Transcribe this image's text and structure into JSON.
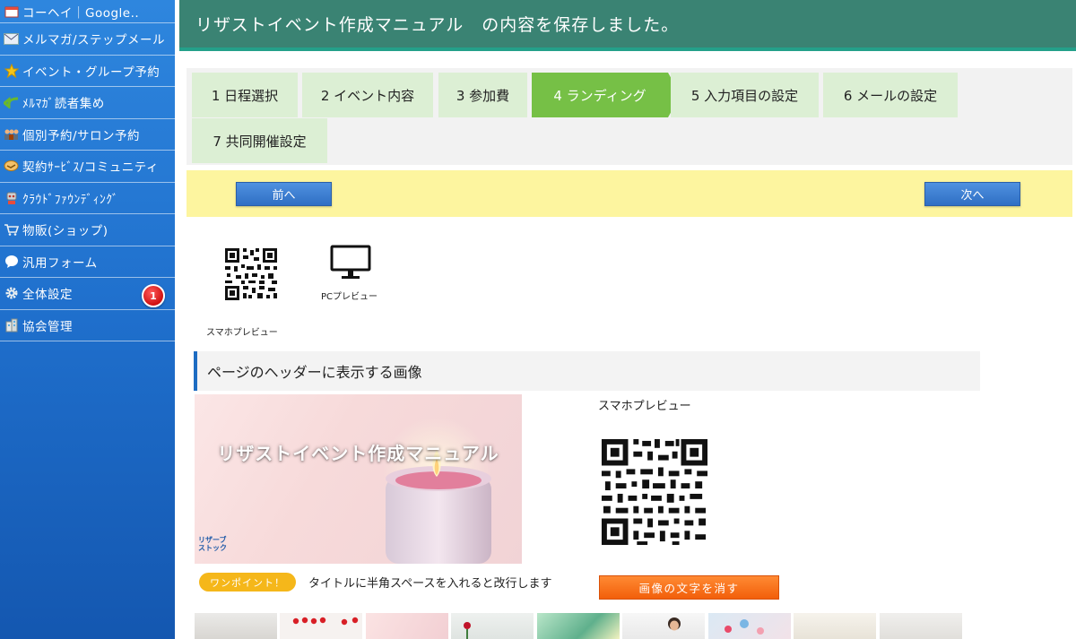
{
  "sidebar": {
    "items": [
      {
        "label": "コーヘイ｜Google..",
        "icon": "calendar-icon"
      },
      {
        "label": "メルマガ/ステップメール",
        "icon": "mail-icon"
      },
      {
        "label": "イベント・グループ予約",
        "icon": "star-icon"
      },
      {
        "label": "ﾒﾙﾏｶﾞ読者集め",
        "icon": "green-arrow-icon"
      },
      {
        "label": "個別予約/サロン予約",
        "icon": "people-icon"
      },
      {
        "label": "契約ｻｰﾋﾞｽ/コミュニティ",
        "icon": "handshake-icon"
      },
      {
        "label": "ｸﾗｳﾄﾞﾌｧｳﾝﾃﾞｨﾝｸﾞ",
        "icon": "robot-icon"
      },
      {
        "label": "物販(ショップ)",
        "icon": "cart-icon"
      },
      {
        "label": "汎用フォーム",
        "icon": "speech-bubble-icon"
      },
      {
        "label": "全体設定",
        "icon": "gear-icon",
        "badge": "1"
      },
      {
        "label": "協会管理",
        "icon": "building-icon"
      }
    ]
  },
  "banner": {
    "text": "リザストイベント作成マニュアル　の内容を保存しました。"
  },
  "tabs": [
    {
      "label": "1  日程選択"
    },
    {
      "label": "2  イベント内容"
    },
    {
      "label": "3  参加費"
    },
    {
      "label": "4  ランディング",
      "active": true
    },
    {
      "label": "5  入力項目の設定"
    },
    {
      "label": "6  メールの設定"
    },
    {
      "label": "7  共同開催設定"
    }
  ],
  "nav": {
    "prev_label": "前へ",
    "next_label": "次へ"
  },
  "preview": {
    "smart_label": "スマホプレビュー",
    "pc_label": "PCプレビュー"
  },
  "section": {
    "title": "ページのヘッダーに表示する画像"
  },
  "header_image": {
    "title": "リザストイベント作成マニュアル",
    "logo_line1": "リザーブ",
    "logo_line2": "ストック"
  },
  "onepoint": {
    "badge": "ワンポイント！",
    "text": "タイトルに半角スペースを入れると改行します"
  },
  "smart_preview": {
    "label": "スマホプレビュー"
  },
  "erase_button": {
    "label": "画像の文字を消す"
  },
  "colors": {
    "banner": "#3a8373",
    "tab_active": "#76c046",
    "tab": "#dcefd4",
    "nav_band": "#fdf59f",
    "button_blue": "#2f6fc4",
    "button_orange": "#f25f0a",
    "badge_yellow": "#f5b71a"
  }
}
